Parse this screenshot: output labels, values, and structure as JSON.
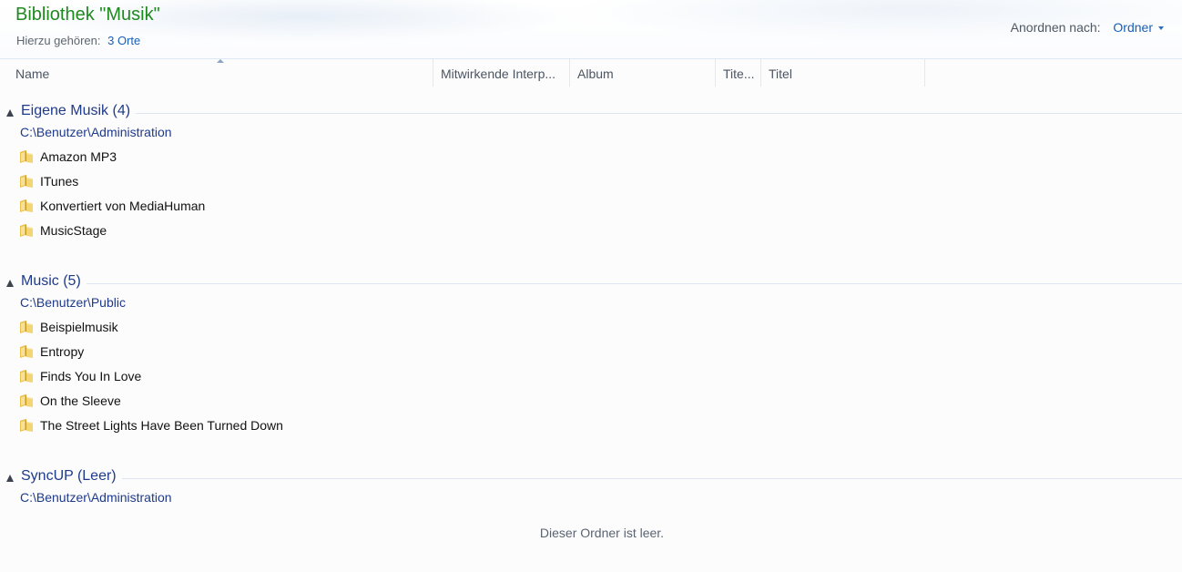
{
  "library": {
    "title": "Bibliothek \"Musik\"",
    "includes_label": "Hierzu gehören:",
    "includes_link": "3 Orte"
  },
  "arrange": {
    "label": "Anordnen nach:",
    "value": "Ordner"
  },
  "columns": [
    {
      "label": "Name"
    },
    {
      "label": "Mitwirkende Interp..."
    },
    {
      "label": "Album"
    },
    {
      "label": "Tite..."
    },
    {
      "label": "Titel"
    }
  ],
  "groups": [
    {
      "title": "Eigene Musik (4)",
      "path": "C:\\Benutzer\\Administration",
      "items": [
        "Amazon MP3",
        "ITunes",
        "Konvertiert von MediaHuman",
        "MusicStage"
      ]
    },
    {
      "title": "Music (5)",
      "path": "C:\\Benutzer\\Public",
      "items": [
        "Beispielmusik",
        "Entropy",
        "Finds You In Love",
        "On the Sleeve",
        "The Street Lights Have Been Turned Down"
      ]
    },
    {
      "title": "SyncUP (Leer)",
      "path": "C:\\Benutzer\\Administration",
      "items": [],
      "empty_message": "Dieser Ordner ist leer."
    }
  ],
  "colors": {
    "title_green": "#1e8a1e",
    "link_blue": "#1a5fb4",
    "group_blue": "#1e3a8a"
  }
}
